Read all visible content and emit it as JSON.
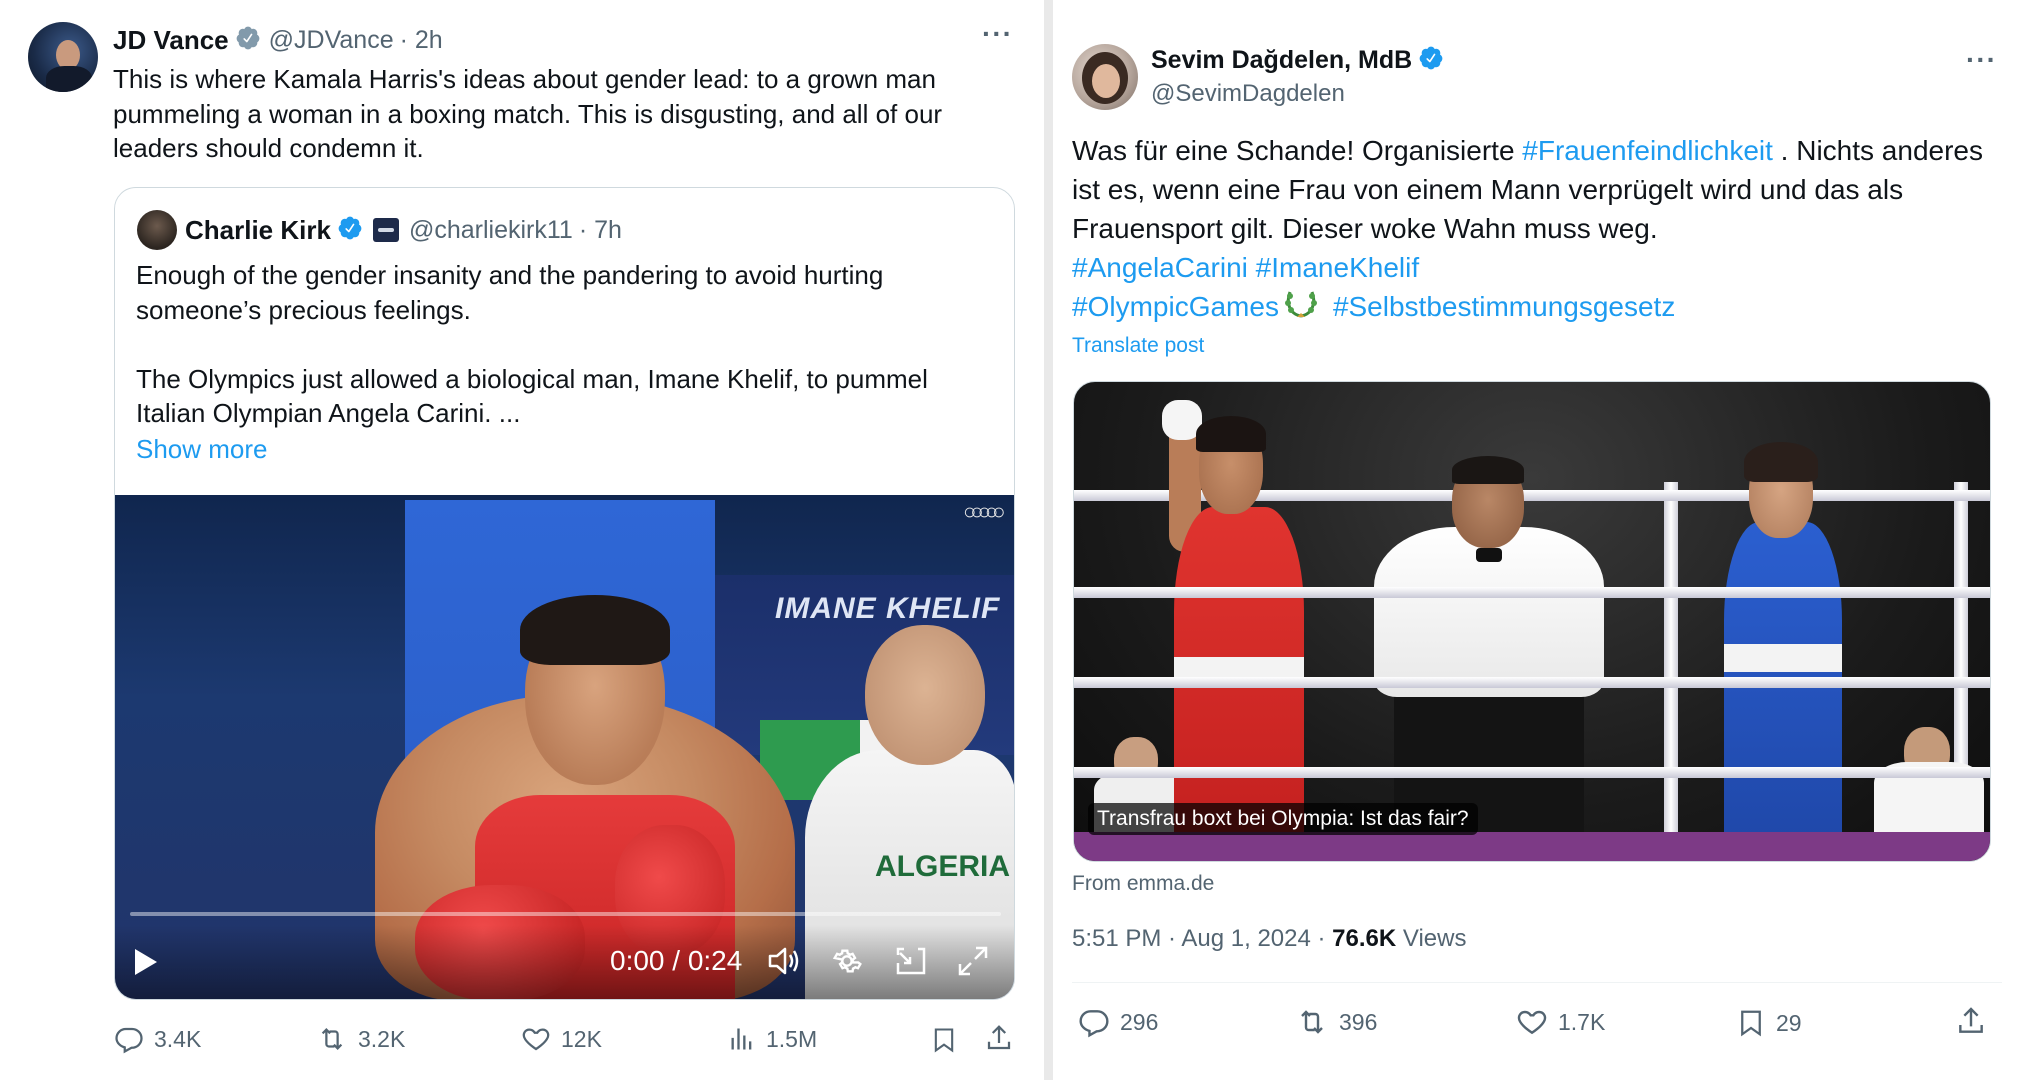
{
  "left_tweet": {
    "author_name": "JD Vance",
    "author_handle": "@JDVance",
    "time": "· 2h",
    "more": "···",
    "text": "This is where Kamala Harris's ideas about gender lead: to a grown man pummeling a woman in a boxing match. This is disgusting, and all of our leaders should condemn it.",
    "quote": {
      "author_name": "Charlie Kirk",
      "author_handle": "@charliekirk11",
      "time": "· 7h",
      "text_p1": "Enough of the gender insanity and the pandering to avoid hurting someone’s precious feelings.",
      "text_p2": "The Olympics just allowed a biological man, Imane Khelif, to pummel Italian Olympian Angela Carini. ...",
      "show_more": "Show more",
      "video": {
        "sign_text": "IMANE KHELIF",
        "shirt_text": "ALGERIA",
        "olympic_rings": "○○○○○",
        "time": "0:00 / 0:24"
      }
    },
    "stats": {
      "replies": "3.4K",
      "reposts": "3.2K",
      "likes": "12K",
      "views": "1.5M"
    }
  },
  "right_tweet": {
    "author_name": "Sevim Dağdelen, MdB",
    "author_handle": "@SevimDagdelen",
    "more": "···",
    "text_part1": "Was für eine Schande! Organisierte ",
    "hashtag1": "#Frauenfeindlichkeit",
    "text_part2": " . Nichts anderes ist es, wenn eine Frau von einem Mann verprügelt wird und das als Frauensport gilt. Dieser woke Wahn muss weg.",
    "hashtag2": "#AngelaCarini",
    "hashtag3": "#ImaneKhelif",
    "hashtag4": "#OlympicGames",
    "hashtag5": "#Selbstbestimmungsgesetz",
    "translate": "Translate post",
    "image_caption": "Transfrau boxt bei Olympia: Ist das fair?",
    "from_site": "From emma.de",
    "time": "5:51 PM · Aug 1, 2024 · ",
    "views_count": "76.6K",
    "views_label": " Views",
    "stats": {
      "replies": "296",
      "reposts": "396",
      "likes": "1.7K",
      "bookmarks": "29"
    }
  },
  "colors": {
    "link": "#1d9bf0",
    "secondary_text": "#536471",
    "primary_text": "#0f1419",
    "verified": "#1d9bf0",
    "border": "#cfd9de"
  }
}
